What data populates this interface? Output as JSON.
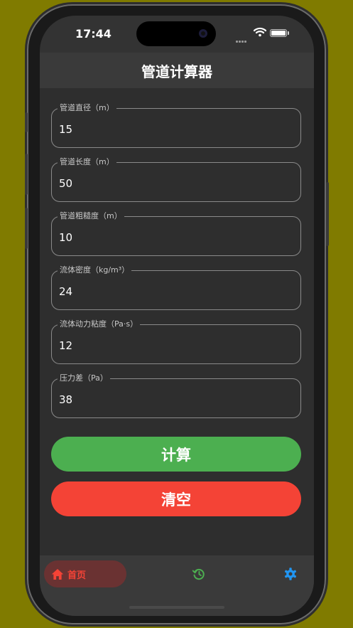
{
  "status_bar": {
    "time": "17:44"
  },
  "app_bar": {
    "title": "管道计算器"
  },
  "fields": [
    {
      "label": "管道直径（m）",
      "value": "15"
    },
    {
      "label": "管道长度（m）",
      "value": "50"
    },
    {
      "label": "管道粗糙度（m）",
      "value": "10"
    },
    {
      "label": "流体密度（kg/m³）",
      "value": "24"
    },
    {
      "label": "流体动力粘度（Pa·s）",
      "value": "12"
    },
    {
      "label": "压力差（Pa）",
      "value": "38"
    }
  ],
  "buttons": {
    "calculate": "计算",
    "clear": "清空"
  },
  "bottom_nav": {
    "home_label": "首页",
    "home_icon": "home-icon",
    "history_icon": "history-icon",
    "settings_icon": "settings-icon"
  },
  "colors": {
    "background": "#807b00",
    "calculate": "#4caf50",
    "clear": "#f44336",
    "history_icon": "#4caf50",
    "settings_icon": "#2196f3",
    "home_active": "#f44336"
  }
}
